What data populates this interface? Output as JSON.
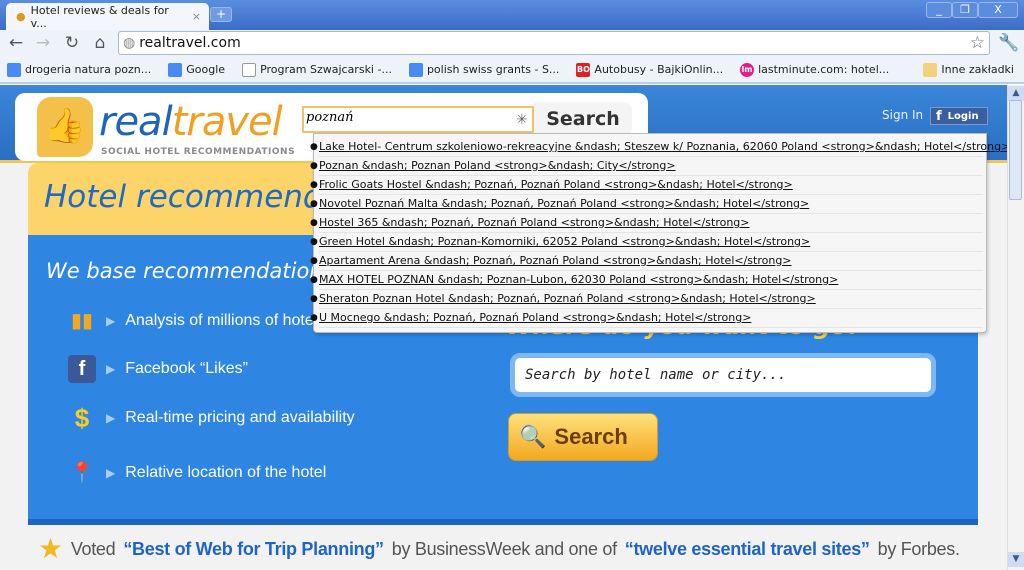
{
  "browser": {
    "tab_title": "Hotel reviews & deals for v...",
    "tab_close": "×",
    "new_tab": "+",
    "window_controls": [
      "_",
      "❐",
      "X"
    ],
    "url": "realtravel.com",
    "bookmarks": [
      {
        "label": "drogeria natura pozn...",
        "icon": "google-icon"
      },
      {
        "label": "Google",
        "icon": "google-icon"
      },
      {
        "label": "Program Szwajcarski -...",
        "icon": "page-icon"
      },
      {
        "label": "polish swiss grants - S...",
        "icon": "google-icon"
      },
      {
        "label": "Autobusy - BajkiOnlin...",
        "icon": "bo-icon",
        "icon_text": "BO"
      },
      {
        "label": "lastminute.com: hotel...",
        "icon": "lm-icon",
        "icon_text": "lm"
      }
    ],
    "other_bookmarks": "Inne zakładki"
  },
  "header": {
    "logo_real": "real",
    "logo_travel": "travel",
    "tagline": "SOCIAL HOTEL RECOMMENDATIONS",
    "search_value": "poznań",
    "search_button": "Search",
    "sign_in": "Sign In",
    "login": "Login"
  },
  "autocomplete": [
    "Lake Hotel- Centrum szkoleniowo-rekreacyjne &ndash; Steszew k/ Poznania, 62060 Poland <strong>&ndash; Hotel</strong>",
    "Poznan &ndash; Poznan Poland <strong>&ndash; City</strong>",
    "Frolic Goats Hostel &ndash; Poznań, Poznań Poland <strong>&ndash; Hotel</strong>",
    "Novotel Poznań Malta &ndash; Poznań, Poznań Poland <strong>&ndash; Hotel</strong>",
    "Hostel 365 &ndash; Poznań, Poznań Poland <strong>&ndash; Hotel</strong>",
    "Green Hotel &ndash; Poznan-Komorniki, 62052 Poland <strong>&ndash; Hotel</strong>",
    "Apartament Arena &ndash; Poznań, Poznań Poland <strong>&ndash; Hotel</strong>",
    "MAX HOTEL POZNAN &ndash; Poznan-Lubon, 62030 Poland <strong>&ndash; Hotel</strong>",
    "Sheraton Poznan Hotel &ndash; Poznań, Poznań Poland <strong>&ndash; Hotel</strong>",
    "U Mocnego &ndash; Poznań, Poznań Poland <strong>&ndash; Hotel</strong>"
  ],
  "hero": {
    "title": "Hotel recommendations",
    "subtitle": "We base recommendations on",
    "features": [
      {
        "label": "Analysis of millions of hotel reviews",
        "icon": "bar-chart-icon"
      },
      {
        "label": "Facebook “Likes”",
        "icon": "facebook-icon"
      },
      {
        "label": "Real-time pricing and availability",
        "icon": "dollar-icon"
      },
      {
        "label": "Relative location of the hotel",
        "icon": "map-pin-icon"
      }
    ],
    "where_heading": "Where do you want to go?",
    "search_placeholder": "Search by hotel name or city...",
    "search_button": "Search"
  },
  "footer": {
    "voted": "Voted",
    "quote1": "“Best of Web for Trip Planning”",
    "by1": "by BusinessWeek and one of",
    "quote2": "“twelve essential travel sites”",
    "by2": "by Forbes."
  },
  "colors": {
    "brand_blue": "#2f86e2",
    "brand_yellow": "#fcd46a",
    "accent_orange": "#f0a020"
  }
}
